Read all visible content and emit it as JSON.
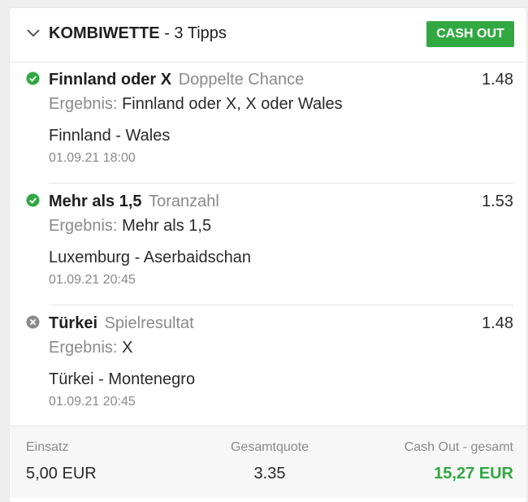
{
  "header": {
    "title": "KOMBIWETTE",
    "subtitle": "- 3 Tipps",
    "cashout_label": "CASH OUT"
  },
  "result_label": "Ergebnis:",
  "tips": [
    {
      "status": "won",
      "selection": "Finnland oder X",
      "market": "Doppelte Chance",
      "odds": "1.48",
      "result": "Finnland oder X, X oder Wales",
      "match": "Finnland - Wales",
      "date": "01.09.21 18:00"
    },
    {
      "status": "won",
      "selection": "Mehr als 1,5",
      "market": "Toranzahl",
      "odds": "1.53",
      "result": "Mehr als 1,5",
      "match": "Luxemburg - Aserbaidschan",
      "date": "01.09.21 20:45"
    },
    {
      "status": "lost",
      "selection": "Türkei",
      "market": "Spielresultat",
      "odds": "1.48",
      "result": "X",
      "match": "Türkei - Montenegro",
      "date": "01.09.21 20:45"
    }
  ],
  "footer": {
    "stake_label": "Einsatz",
    "stake_value": "5,00 EUR",
    "total_odds_label": "Gesamtquote",
    "total_odds_value": "3.35",
    "cashout_label": "Cash Out - gesamt",
    "cashout_value": "15,27 EUR"
  },
  "colors": {
    "accent": "#32a842",
    "lost": "#8a8a8a",
    "muted_text": "#8a8a8a"
  }
}
